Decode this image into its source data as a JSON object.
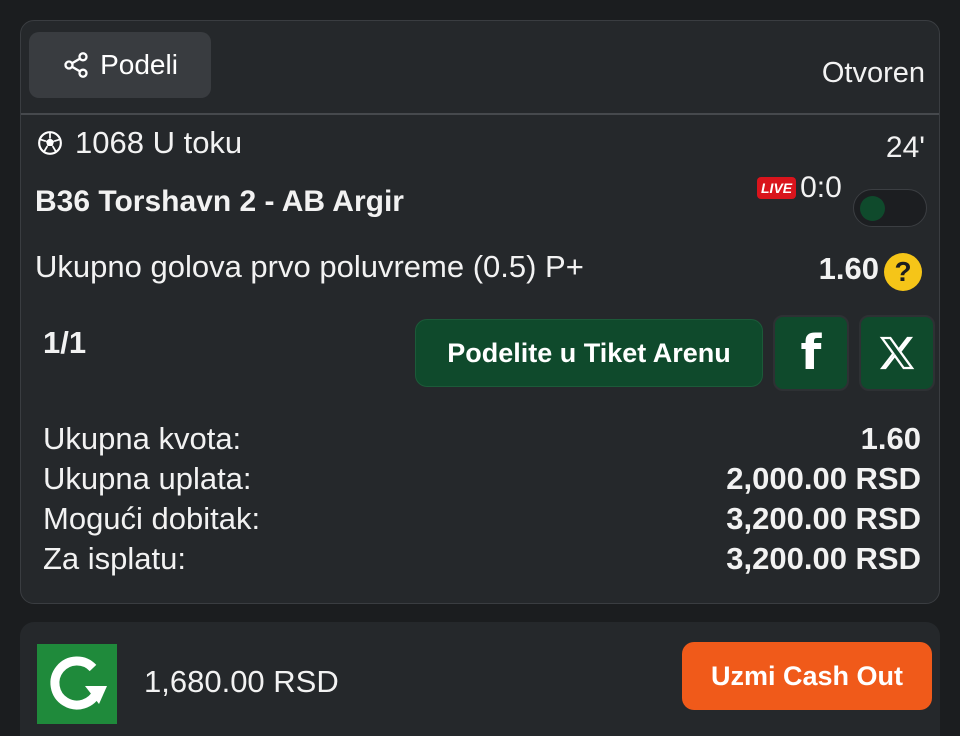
{
  "header": {
    "share_label": "Podeli",
    "status": "Otvoren"
  },
  "event": {
    "code_status": "1068 U toku",
    "minute": "24'",
    "match": "B36 Torshavn 2 - AB Argir",
    "live_badge": "LIVE",
    "score": "0:0"
  },
  "bet": {
    "market": "Ukupno golova prvo poluvreme (0.5) P+",
    "odd": "1.60",
    "help": "?"
  },
  "share": {
    "count": "1/1",
    "arena_button": "Podelite u Tiket Arenu",
    "facebook_glyph": "f"
  },
  "summary": [
    {
      "label": "Ukupna kvota:",
      "value": "1.60"
    },
    {
      "label": "Ukupna uplata:",
      "value": "2,000.00 RSD"
    },
    {
      "label": "Mogući dobitak:",
      "value": "3,200.00 RSD"
    },
    {
      "label": "Za isplatu:",
      "value": "3,200.00 RSD"
    }
  ],
  "cashout": {
    "amount": "1,680.00 RSD",
    "button": "Uzmi Cash Out"
  },
  "colors": {
    "background": "#1b1d1f",
    "card": "#25282b",
    "green": "#0f4a2c",
    "orange": "#f05a1a",
    "yellow": "#f5c518",
    "live_red": "#d9141c",
    "cashout_green": "#1f8a3b"
  },
  "icons": {
    "share": "share-icon",
    "sport": "soccer-ball-icon",
    "help": "question-icon",
    "facebook": "facebook-icon",
    "x": "x-logo-icon",
    "cashout": "cashout-logo-icon"
  }
}
